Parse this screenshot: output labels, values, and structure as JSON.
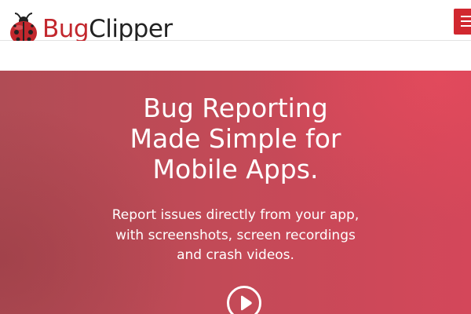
{
  "header": {
    "logo": {
      "text_part1": "Bug",
      "text_part2": "Clipper",
      "icon": "ladybug-icon"
    },
    "menu_icon": "hamburger-menu-icon"
  },
  "hero": {
    "title_lines": [
      "Bug Reporting",
      "Made Simple for",
      "Mobile Apps."
    ],
    "subtitle_lines": [
      "Report issues directly from your app,",
      "with screenshots, screen recordings",
      "and crash videos."
    ],
    "play_icon": "play-icon"
  },
  "colors": {
    "brand_red": "#c2272d",
    "logo_dark": "#222222",
    "menu_red": "#d1282f",
    "hero_left": "#b04c55",
    "hero_right": "#d4475a",
    "hero_text": "#ffffff"
  }
}
